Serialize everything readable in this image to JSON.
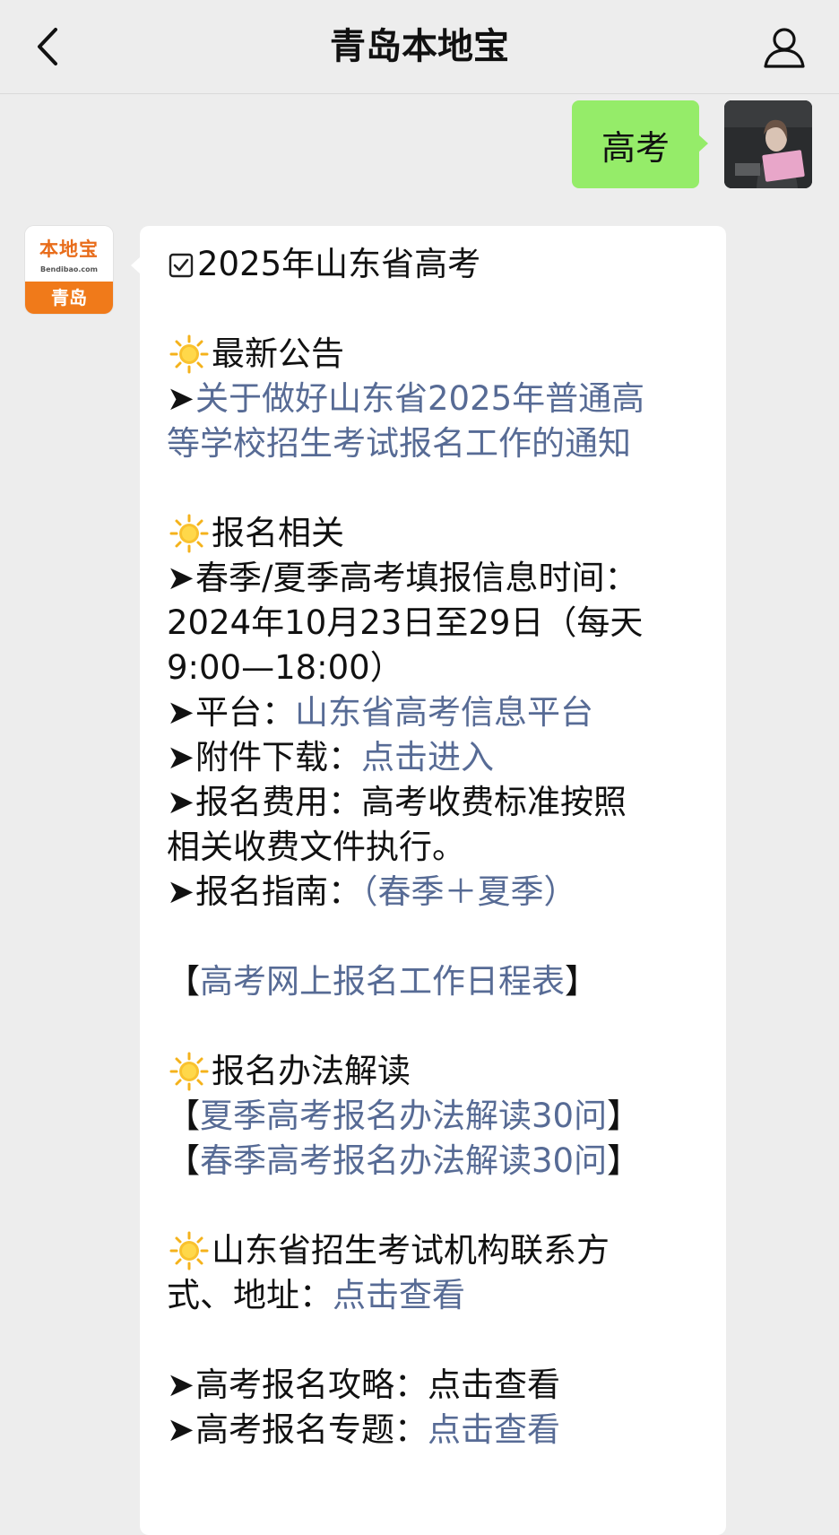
{
  "header": {
    "title": "青岛本地宝"
  },
  "my_message": {
    "text": "高考"
  },
  "bot_avatar": {
    "logo_cn": "本地宝",
    "logo_en": "Bendibao.com",
    "city": "青岛"
  },
  "bot_message": {
    "heading": "2025年山东省高考",
    "sec1_title": "最新公告",
    "notice_link_1": "关于做好山东省2025年普通高",
    "notice_link_2": "等学校招生考试报名工作的通知",
    "sec2_title": "报名相关",
    "info_time_1": "春季/夏季高考填报信息时间：",
    "info_time_2": "2024年10月23日至29日（每天",
    "info_time_3": "9:00—18:00）",
    "platform_label": "平台：",
    "platform_link": "山东省高考信息平台",
    "attach_label": "附件下载：",
    "attach_link": "点击进入",
    "fee_label": "报名费用：",
    "fee_text": "高考收费标准按照",
    "fee_text_2": "相关收费文件执行。",
    "guide_label": "报名指南：",
    "guide_link": "（春季＋夏季）",
    "bracket_open": "【",
    "bracket_close": "】",
    "schedule_link": "高考网上报名工作日程表",
    "sec3_title": "报名办法解读",
    "summer_link": "夏季高考报名办法解读30问",
    "spring_link": "春季高考报名办法解读30问",
    "sec4_title_1": "山东省招生考试机构联系方",
    "sec4_title_2": "式、地址：",
    "sec4_link": "点击查看",
    "strategy_label": "高考报名攻略：",
    "strategy_text": "点击查看",
    "topic_label": "高考报名专题：",
    "topic_link": "点击查看"
  },
  "colors": {
    "link": "#576b95",
    "my_bubble": "#95ec69",
    "background": "#ededed"
  },
  "icons": [
    "back-chevron-icon",
    "user-profile-icon",
    "sun-emoji-icon",
    "checkbox-icon"
  ]
}
